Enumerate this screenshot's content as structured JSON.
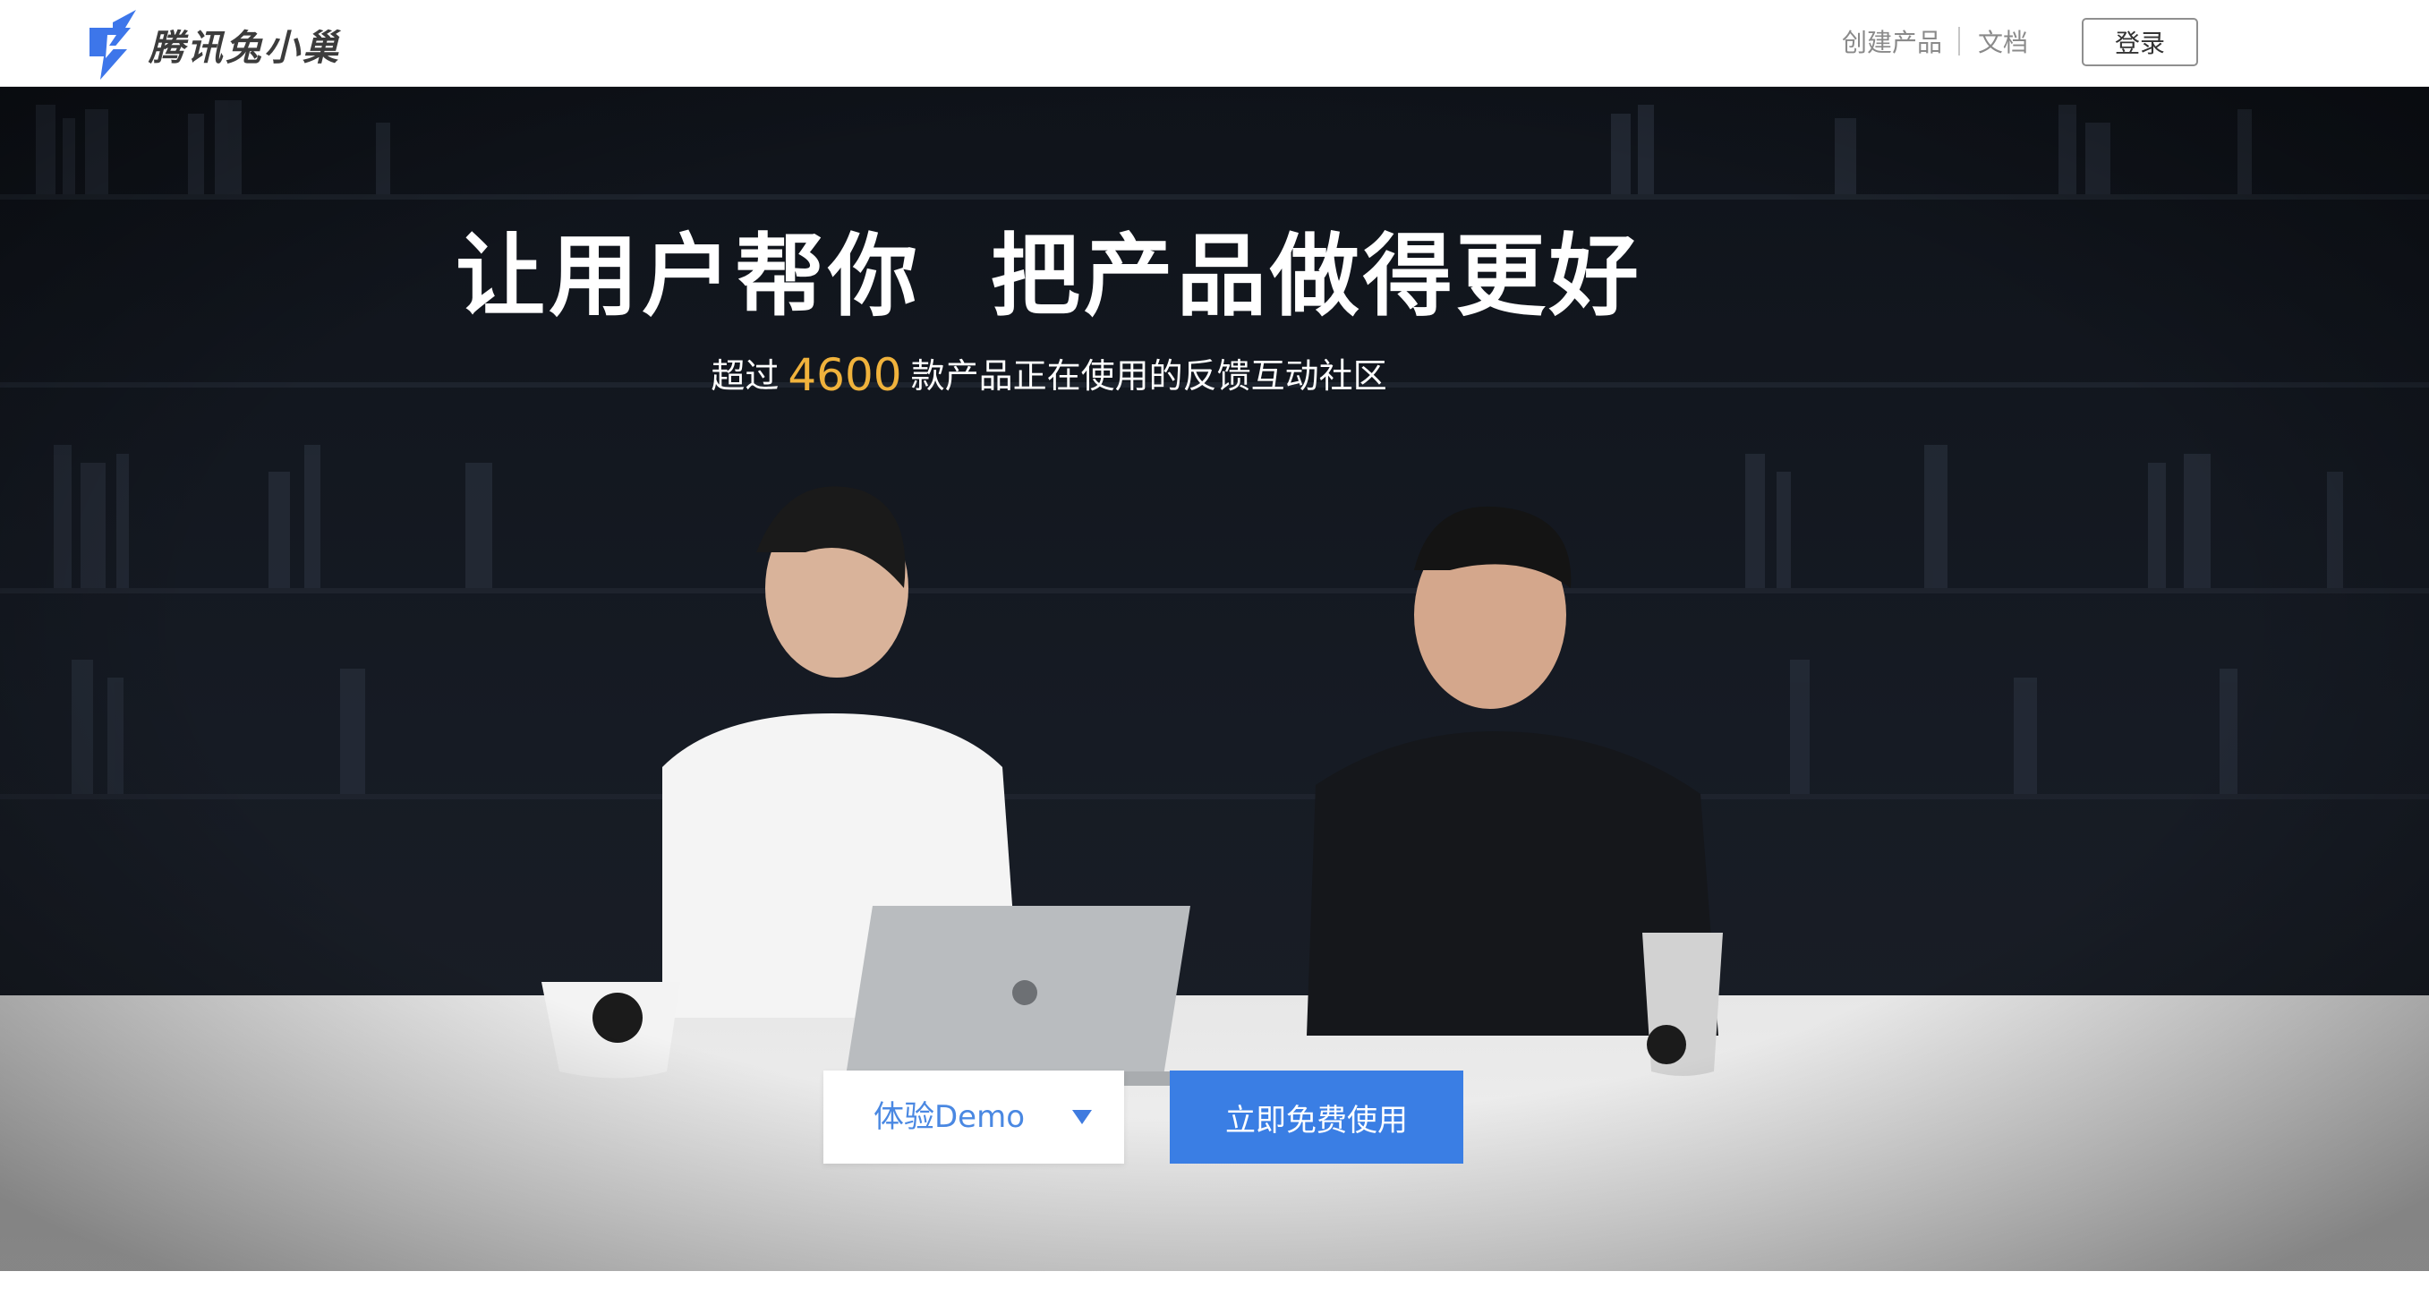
{
  "brand": {
    "name": "腾讯兔小巢",
    "accent_color": "#3a7ee4",
    "highlight_color": "#f0b23c"
  },
  "nav": {
    "create_product": "创建产品",
    "docs": "文档",
    "login": "登录"
  },
  "hero": {
    "title": "让用户帮你  把产品做得更好",
    "subtitle_prefix": "超过",
    "product_count": "4600",
    "subtitle_suffix": "款产品正在使用的反馈互动社区",
    "background_image": "photo of two people at a desk giving thumbs up, laptop and mugs, bookshelf background"
  },
  "cta": {
    "demo_label": "体验Demo",
    "demo_icon": "caret-down-icon",
    "primary_label": "立即免费使用"
  }
}
